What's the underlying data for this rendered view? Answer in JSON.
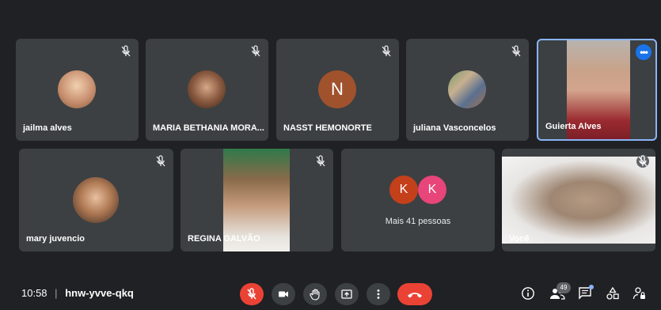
{
  "meeting": {
    "time": "10:58",
    "separator": "|",
    "code": "hnw-yvve-qkq"
  },
  "participants": [
    {
      "name": "jailma alves",
      "muted": true,
      "display": "photo"
    },
    {
      "name": "MARIA BETHANIA MORA...",
      "muted": true,
      "display": "photo"
    },
    {
      "name": "NASST HEMONORTE",
      "muted": true,
      "display": "initial",
      "initial": "N",
      "color": "#a0522d"
    },
    {
      "name": "juliana Vasconcelos",
      "muted": true,
      "display": "photo"
    },
    {
      "name": "Guierta Alves",
      "muted": false,
      "display": "video",
      "active_speaker": true
    },
    {
      "name": "mary juvencio",
      "muted": true,
      "display": "photo"
    },
    {
      "name": "REGINA GALVÃO",
      "muted": true,
      "display": "video"
    },
    {
      "name": "Você",
      "muted": true,
      "display": "video"
    }
  ],
  "overflow": {
    "label": "Mais 41 pessoas",
    "initials": [
      {
        "letter": "K",
        "color": "#c4401b"
      },
      {
        "letter": "K",
        "color": "#e8457a"
      }
    ]
  },
  "controls": {
    "people_count": "49",
    "accent_red": "#ea4335",
    "accent_blue": "#1a73e8"
  }
}
